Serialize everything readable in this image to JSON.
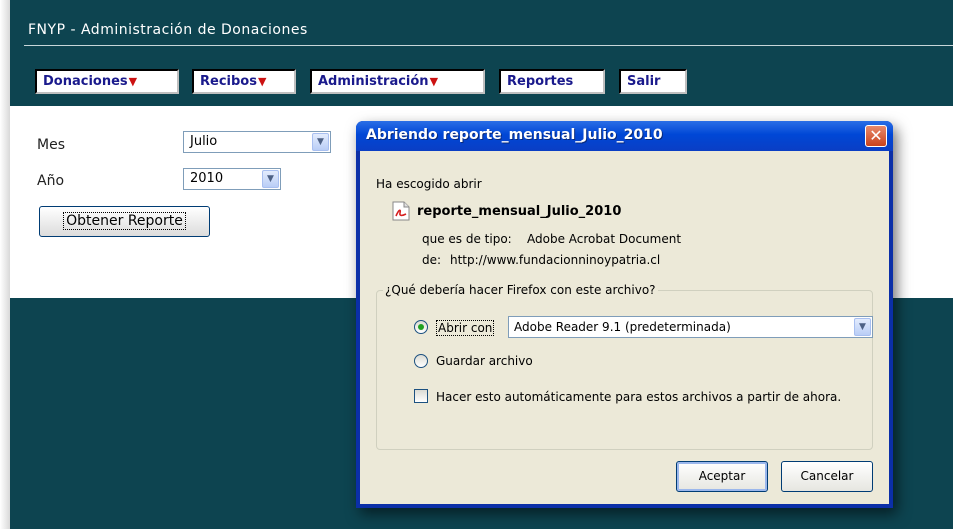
{
  "app": {
    "title": "FNYP - Administración de Donaciones"
  },
  "menu": [
    {
      "label": "Donaciones",
      "has_dropdown": true
    },
    {
      "label": "Recibos",
      "has_dropdown": true
    },
    {
      "label": "Administración",
      "has_dropdown": true
    },
    {
      "label": "Reportes",
      "has_dropdown": false
    },
    {
      "label": "Salir",
      "has_dropdown": false
    }
  ],
  "report_form": {
    "month_label": "Mes",
    "month_value": "Julio",
    "year_label": "Año",
    "year_value": "2010",
    "submit_label": "Obtener Reporte"
  },
  "dialog": {
    "title": "Abriendo reporte_mensual_Julio_2010",
    "intro": "Ha escogido abrir",
    "file_name": "reporte_mensual_Julio_2010",
    "type_label": "que es de tipo:",
    "type_value": "Adobe Acrobat Document",
    "from_label": "de:",
    "from_value": "http://www.fundacionninoypatria.cl",
    "question": "¿Qué debería hacer Firefox con este archivo?",
    "open_with_label": "Abrir con",
    "open_with_app": "Adobe Reader 9.1 (predeterminada)",
    "save_label": "Guardar archivo",
    "auto_label": "Hacer esto automáticamente para estos archivos a partir de ahora.",
    "selected_option": "open_with",
    "auto_checked": false,
    "ok_label": "Aceptar",
    "cancel_label": "Cancelar"
  },
  "colors": {
    "header_bg": "#0d4450",
    "menu_text": "#1a1a8c",
    "menu_arrow": "#cc1111",
    "dialog_title_bg": "#0047d6",
    "dialog_body_bg": "#ece9d8"
  },
  "icons": {
    "dropdown": "chevron-down-icon",
    "close": "close-icon",
    "file": "pdf-file-icon"
  }
}
